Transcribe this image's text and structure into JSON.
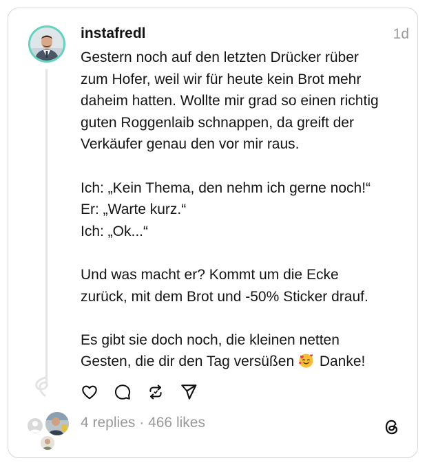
{
  "post": {
    "username": "instafredl",
    "timestamp": "1d",
    "body_lines": [
      "Gestern noch auf den letzten Drücker rüber",
      "zum Hofer, weil wir für heute kein Brot mehr",
      "daheim hatten. Wollte mir grad so einen richtig",
      "guten Roggenlaib schnappen, da greift der",
      "Verkäufer genau den vor mir raus.",
      "",
      "Ich: „Kein Thema, den nehm ich gerne noch!“",
      "Er: „Warte kurz.“",
      "Ich: „Ok...“",
      "",
      "Und was macht er? Kommt um die Ecke",
      "zurück, mit dem Brot und -50% Sticker drauf.",
      "",
      "Es gibt sie doch noch, die kleinen netten"
    ],
    "last_line_before_emoji": "Gesten, die dir den Tag versüßen",
    "last_line_after_emoji": " Danke!",
    "emoji": "smiling-face-with-hearts-emoji",
    "replies_text": "4 replies",
    "separator": "·",
    "likes_text": "466 likes"
  },
  "actions": {
    "like_icon": "heart-icon",
    "comment_icon": "comment-bubble-icon",
    "repost_icon": "repost-icon",
    "share_icon": "send-icon"
  },
  "brand": {
    "logo_icon": "threads-logo-icon",
    "avatar_ring_color": "#5fd3bd",
    "text_color": "#141414",
    "muted_color": "#999999"
  }
}
